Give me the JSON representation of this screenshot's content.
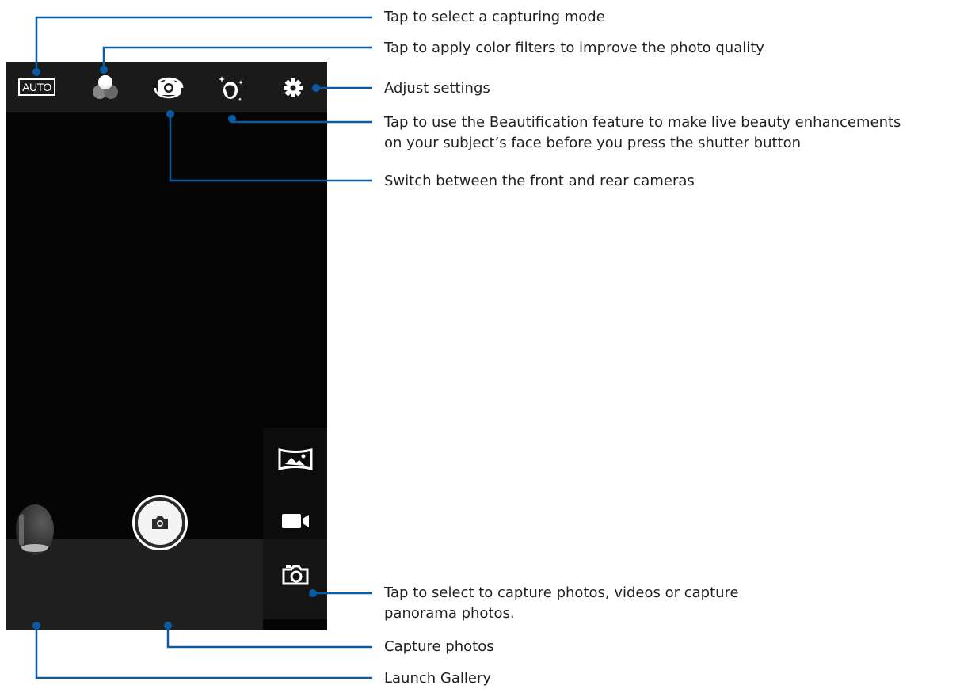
{
  "camera": {
    "mode_button_label": "AUTO",
    "top_icons": [
      "auto-mode",
      "color-filter-icon",
      "switch-camera-icon",
      "beautification-icon",
      "settings-gear-icon"
    ],
    "side_modes": [
      "panorama-icon",
      "video-camera-icon",
      "photo-camera-icon"
    ],
    "shutter_icon": "camera-icon",
    "gallery_thumbnail": "last-photo-thumbnail"
  },
  "annotations": {
    "capture_mode": "Tap to select a capturing mode",
    "color_filters": "Tap to apply color filters to improve the photo quality",
    "settings": "Adjust settings",
    "beautification_line1": "Tap to use the Beautification feature to make live beauty enhancements",
    "beautification_line2": "on your subject’s face before you press the shutter button",
    "switch_camera": "Switch between the front and rear cameras",
    "capture_type_line1": "Tap to select to capture photos, videos or capture",
    "capture_type_line2": "panorama photos.",
    "capture_photos": "Capture photos",
    "launch_gallery": "Launch Gallery"
  },
  "colors": {
    "callout_line": "#0a5ba3",
    "text": "#231f20",
    "screen_bg": "#050505"
  }
}
